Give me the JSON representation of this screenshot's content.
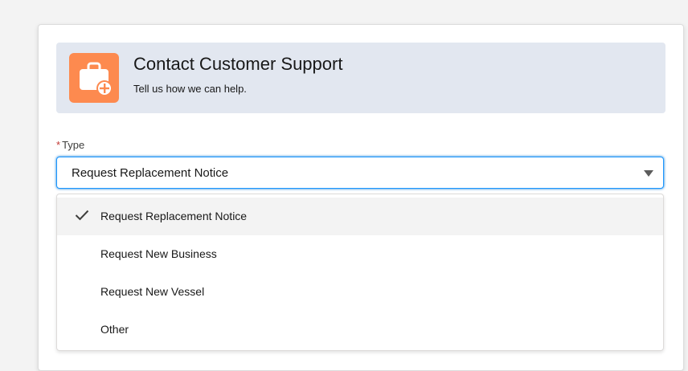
{
  "header": {
    "title": "Contact Customer Support",
    "subtitle": "Tell us how we can help.",
    "icon": "briefcase-plus-icon",
    "icon_color": "#fd8a4f"
  },
  "form": {
    "type_field": {
      "required_marker": "*",
      "label": "Type",
      "selected_value": "Request Replacement Notice",
      "options": [
        {
          "label": "Request Replacement Notice",
          "selected": true
        },
        {
          "label": "Request New Business",
          "selected": false
        },
        {
          "label": "Request New Vessel",
          "selected": false
        },
        {
          "label": "Other",
          "selected": false
        }
      ]
    }
  },
  "colors": {
    "focus_border": "#1b96ff",
    "header_bg": "#e2e7f0",
    "required": "#c23934"
  }
}
